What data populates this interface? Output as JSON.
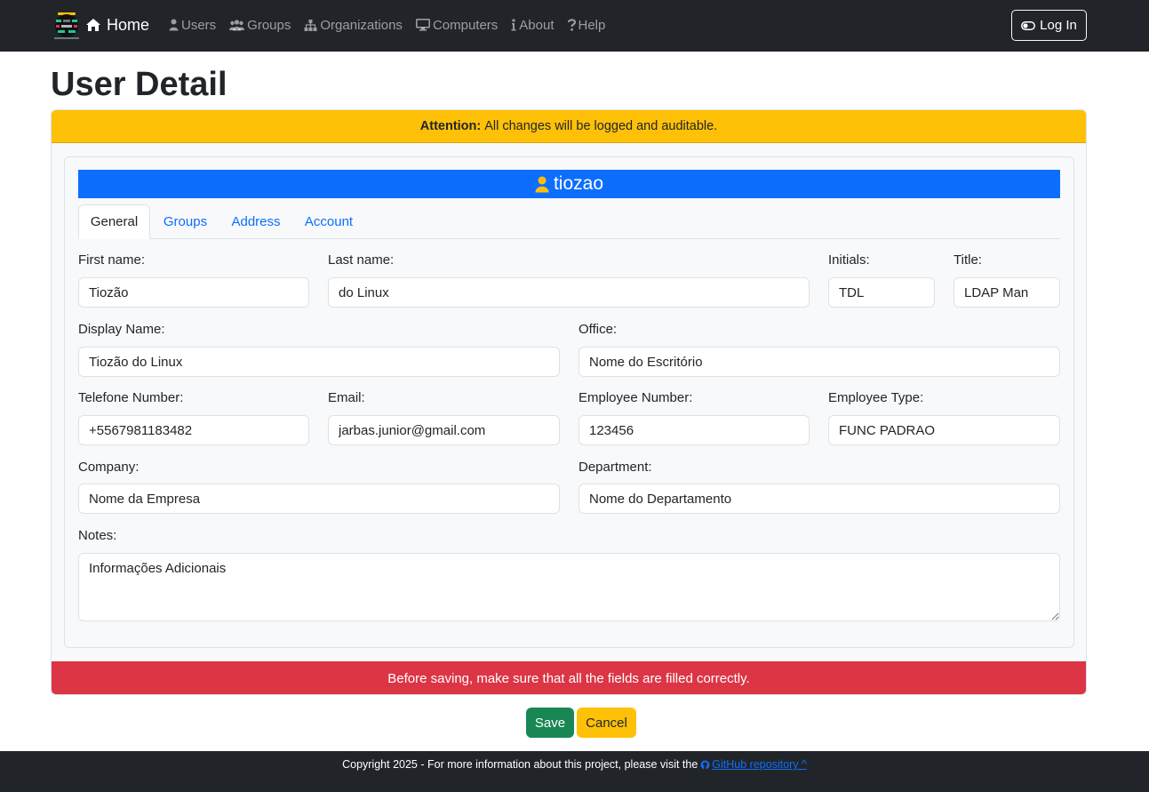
{
  "navbar": {
    "home_label": "Home",
    "links": [
      "Users",
      "Groups",
      "Organizations",
      "Computers",
      "About",
      "Help"
    ],
    "login_label": "Log In"
  },
  "page": {
    "title": "User Detail"
  },
  "alert_header": {
    "strong": "Attention:",
    "text": "All changes will be logged and auditable."
  },
  "user": {
    "username": "tiozao"
  },
  "tabs": [
    "General",
    "Groups",
    "Address",
    "Account"
  ],
  "form": {
    "first_name": {
      "label": "First name:",
      "value": "Tiozão"
    },
    "last_name": {
      "label": "Last name:",
      "value": "do Linux"
    },
    "initials": {
      "label": "Initials:",
      "value": "TDL"
    },
    "title": {
      "label": "Title:",
      "value": "LDAP Man"
    },
    "display_name": {
      "label": "Display Name:",
      "value": "Tiozão do Linux"
    },
    "office": {
      "label": "Office:",
      "value": "Nome do Escritório"
    },
    "telephone": {
      "label": "Telefone Number:",
      "value": "+5567981183482"
    },
    "email": {
      "label": "Email:",
      "value": "jarbas.junior@gmail.com"
    },
    "employee_number": {
      "label": "Employee Number:",
      "value": "123456"
    },
    "employee_type": {
      "label": "Employee Type:",
      "value": "FUNC PADRAO"
    },
    "company": {
      "label": "Company:",
      "value": "Nome da Empresa"
    },
    "department": {
      "label": "Department:",
      "value": "Nome do Departamento"
    },
    "notes": {
      "label": "Notes:",
      "value": "Informações Adicionais"
    }
  },
  "alert_footer": {
    "text": "Before saving, make sure that all the fields are filled correctly."
  },
  "buttons": {
    "save": "Save",
    "cancel": "Cancel"
  },
  "footer": {
    "text": "Copyright 2025 - For more information about this project, please visit the",
    "link_label": "GitHub repository ^"
  },
  "colors": {
    "navbar_bg": "#212529",
    "primary": "#0d6efd",
    "warning": "#ffc107",
    "danger": "#dc3545",
    "success": "#198754",
    "user_icon": "#ffc107"
  }
}
